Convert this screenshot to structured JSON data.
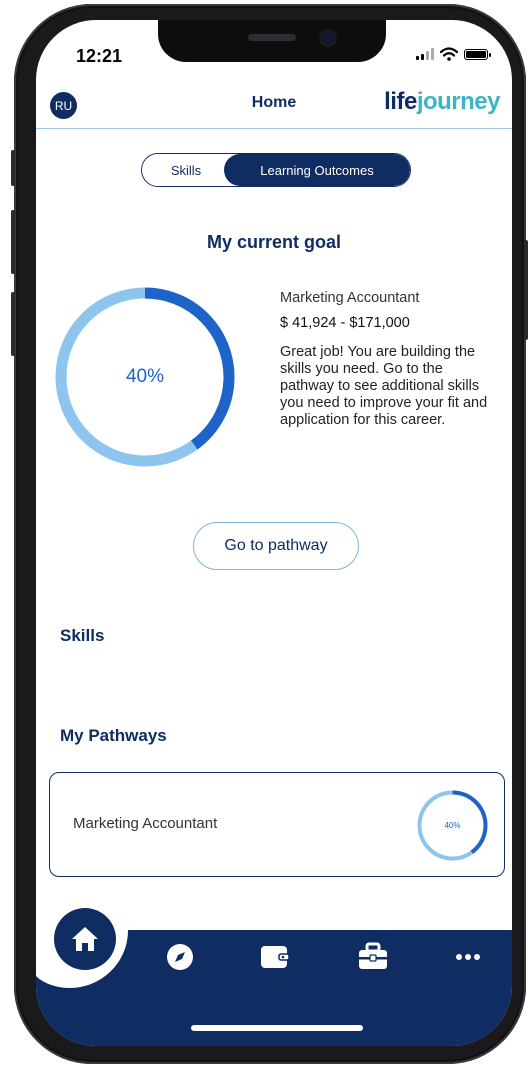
{
  "status_bar": {
    "time": "12:21"
  },
  "header": {
    "avatar_initials": "RU",
    "title": "Home",
    "logo_part1": "life",
    "logo_part2": "journey"
  },
  "segmented_control": {
    "skills_label": "Skills",
    "learning_outcomes_label": "Learning Outcomes",
    "selected": "Learning Outcomes"
  },
  "goal": {
    "section_title": "My current goal",
    "progress_label": "40%",
    "progress": 0.4,
    "career": "Marketing Accountant",
    "salary": "$ 41,924 - $171,000",
    "message": "Great job! You are building the skills you need. Go to the pathway to see additional skills you need to improve your fit and application for this career."
  },
  "pathway_button": {
    "label": "Go to pathway"
  },
  "skills_section": {
    "title": "Skills"
  },
  "pathways_section": {
    "title": "My Pathways",
    "items": [
      {
        "name": "Marketing Accountant",
        "progress_label": "40%",
        "progress": 0.4
      }
    ]
  },
  "tabbar": {
    "items": [
      "home-icon",
      "compass-icon",
      "wallet-icon",
      "briefcase-icon",
      "more-icon"
    ],
    "active": "home-icon"
  },
  "colors": {
    "navy": "#0f2d62",
    "accent_blue": "#1e63c8",
    "light_blue": "#8ec5ee",
    "teal": "#3db5c4"
  }
}
